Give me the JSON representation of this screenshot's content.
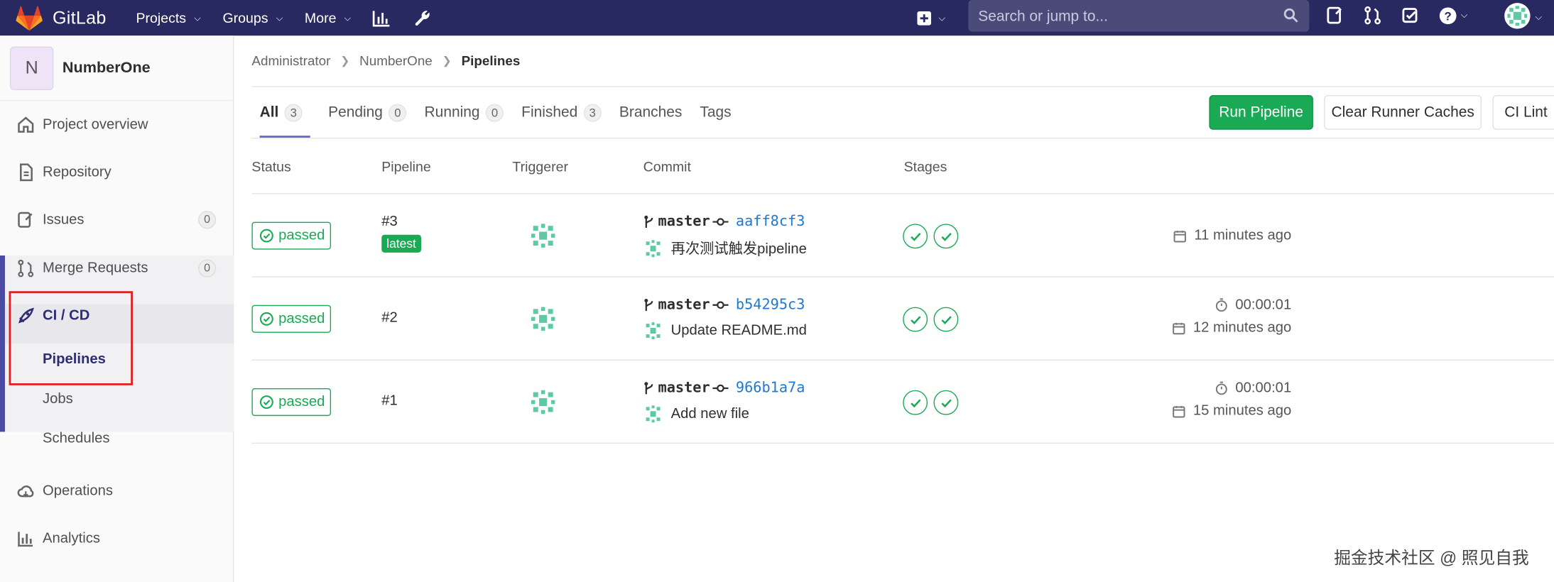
{
  "topbar": {
    "brand": "GitLab",
    "nav": [
      "Projects",
      "Groups",
      "More"
    ],
    "search_placeholder": "Search or jump to..."
  },
  "sidebar": {
    "project_initial": "N",
    "project_name": "NumberOne",
    "items": [
      {
        "label": "Project overview",
        "icon": "home-icon"
      },
      {
        "label": "Repository",
        "icon": "doc-icon"
      },
      {
        "label": "Issues",
        "icon": "issues-icon",
        "count": "0"
      },
      {
        "label": "Merge Requests",
        "icon": "merge-request-icon",
        "count": "0"
      },
      {
        "label": "CI / CD",
        "icon": "rocket-icon"
      },
      {
        "label": "Operations",
        "icon": "cloud-icon"
      },
      {
        "label": "Analytics",
        "icon": "chart-icon"
      }
    ],
    "ci_sub": [
      "Pipelines",
      "Jobs",
      "Schedules"
    ]
  },
  "breadcrumb": [
    "Administrator",
    "NumberOne",
    "Pipelines"
  ],
  "tabs": [
    {
      "label": "All",
      "count": "3"
    },
    {
      "label": "Pending",
      "count": "0"
    },
    {
      "label": "Running",
      "count": "0"
    },
    {
      "label": "Finished",
      "count": "3"
    },
    {
      "label": "Branches"
    },
    {
      "label": "Tags"
    }
  ],
  "buttons": {
    "run": "Run Pipeline",
    "clear": "Clear Runner Caches",
    "lint": "CI Lint"
  },
  "columns": [
    "Status",
    "Pipeline",
    "Triggerer",
    "Commit",
    "Stages"
  ],
  "pipelines": [
    {
      "status": "passed",
      "id": "#3",
      "latest": "latest",
      "branch": "master",
      "sha": "aaff8cf3",
      "message": "再次测试触发pipeline",
      "duration": "",
      "ago": "11 minutes ago"
    },
    {
      "status": "passed",
      "id": "#2",
      "branch": "master",
      "sha": "b54295c3",
      "message": "Update README.md",
      "duration": "00:00:01",
      "ago": "12 minutes ago"
    },
    {
      "status": "passed",
      "id": "#1",
      "branch": "master",
      "sha": "966b1a7a",
      "message": "Add new file",
      "duration": "00:00:01",
      "ago": "15 minutes ago"
    }
  ],
  "watermark": "掘金技术社区 @ 照见自我",
  "colors": {
    "topbar": "#292961",
    "success": "#1aaa55",
    "link": "#1f78d1",
    "highlight": "#e02020"
  }
}
